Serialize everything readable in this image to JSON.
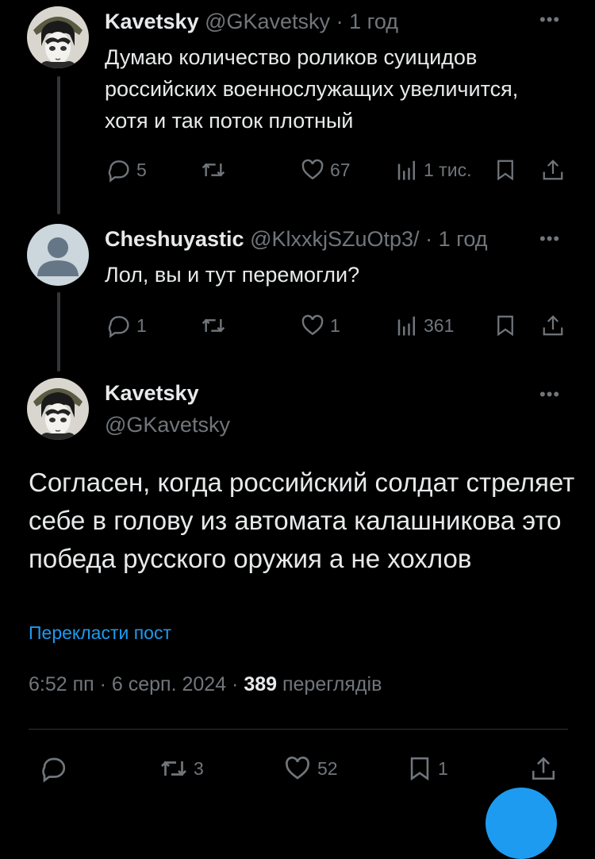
{
  "colors": {
    "background": "#000000",
    "text": "#e7e9ea",
    "muted": "#71767b",
    "link": "#1d9bf0",
    "divider": "#2f3336"
  },
  "tweet1": {
    "name": "Kavetsky",
    "handle": "@GKavetsky",
    "time": "· 1 год",
    "text": "Думаю количество роликов суицидов российских военнослужащих увеличится, хотя и так поток плотный",
    "replies": "5",
    "retweets": "",
    "likes": "67",
    "views": "1 тис."
  },
  "tweet2": {
    "name": "Cheshuyastic",
    "handle": "@KlxxkjSZuOtp3/",
    "time": "· 1 год",
    "text": "Лол, вы и тут перемогли?",
    "replies": "1",
    "retweets": "",
    "likes": "1",
    "views": "361"
  },
  "main": {
    "name": "Kavetsky",
    "handle": "@GKavetsky",
    "text": "Согласен, когда российский солдат стреляет себе в голову из автомата калашникова это победа русского оружия а не хохлов",
    "translate": "Перекласти пост",
    "time": "6:52 пп · 6 серп. 2024 · ",
    "views_count": "389",
    "views_label": " переглядів",
    "retweets": "3",
    "likes": "52",
    "bookmarks": "1"
  },
  "icons": [
    "reply-icon",
    "retweet-icon",
    "like-icon",
    "views-icon",
    "bookmark-icon",
    "share-icon",
    "more-icon"
  ]
}
